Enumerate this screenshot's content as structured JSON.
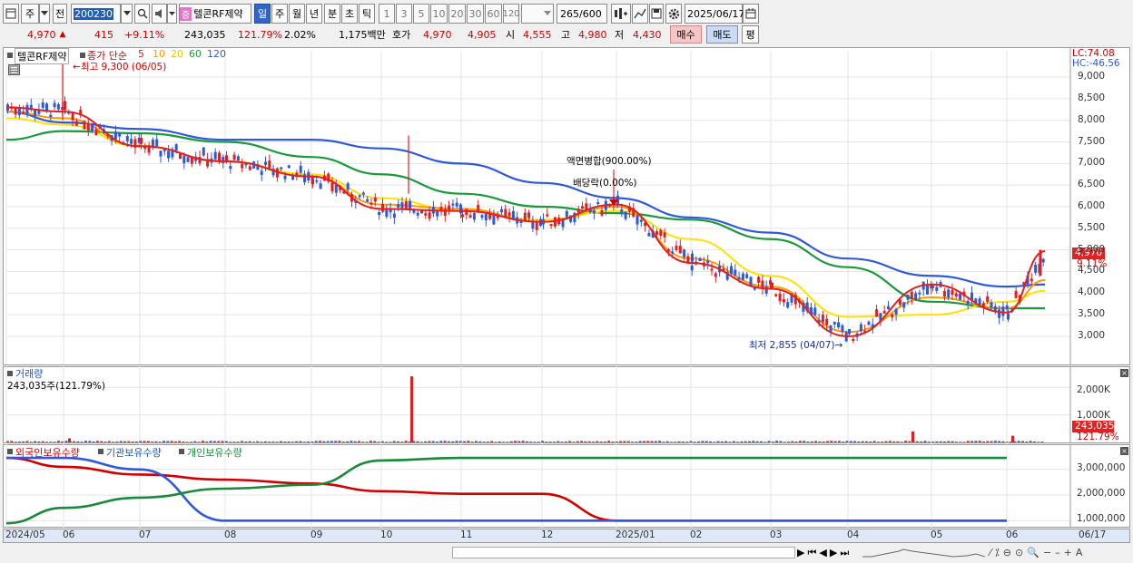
{
  "toolbar": {
    "market_label": "주",
    "prev_label": "전",
    "code": "200230",
    "stock_name": "텔콘RF제약",
    "stock_badge": "증",
    "periods": [
      "일",
      "주",
      "월",
      "년",
      "분",
      "초",
      "틱"
    ],
    "active_period": "일",
    "intervals": [
      "1",
      "3",
      "5",
      "10",
      "20",
      "30",
      "60",
      "120"
    ],
    "count": "265",
    "total": "/600",
    "date": "2025/06/17"
  },
  "quote": {
    "price": "4,970",
    "change": "415",
    "change_pct": "+9.11%",
    "volume": "243,035",
    "volume_ratio": "121.79%",
    "turnover_rate": "2.02%",
    "amount": "1,175백만",
    "ask_label": "호가",
    "ask1": "4,970",
    "ask2": "4,905",
    "open_label": "시",
    "open": "4,555",
    "high_label": "고",
    "high": "4,980",
    "low_label": "저",
    "low": "4,430",
    "buy_label": "매수",
    "sell_label": "매도",
    "eval_label": "평"
  },
  "price_chart": {
    "title": "텔콘RF제약",
    "ma_label": "종가 단순",
    "ma_periods": [
      "5",
      "10",
      "20",
      "60",
      "120"
    ],
    "ma_colors": [
      "#e02020",
      "#ff9a00",
      "#ffe000",
      "#1a9a3a",
      "#2f59d9"
    ],
    "lc": "LC:74.08",
    "hc": "HC:-46.56",
    "high_note": "최고 9,300 (06/05)",
    "low_note": "최저 2,855 (04/07)",
    "event1": "액면병합(900.00%)",
    "event2": "배당락(0.00%)",
    "y_ticks": [
      "9,000",
      "8,500",
      "8,000",
      "7,500",
      "7,000",
      "6,500",
      "6,000",
      "5,500",
      "5,000",
      "4,500",
      "4,000",
      "3,500",
      "3,000"
    ],
    "last_price": "4,970",
    "last_pct": "9.11%"
  },
  "volume_chart": {
    "title": "거래량",
    "value": "243,035주(121.79%)",
    "y_ticks": [
      "2,000K",
      "1,000K"
    ],
    "last": "243,035",
    "last_pct": "121.79%"
  },
  "holding_chart": {
    "legends": [
      "외국인보유수량",
      "기관보유수량",
      "개인보유수량"
    ],
    "y_ticks": [
      "3,000,000",
      "2,000,000",
      "1,000,000"
    ]
  },
  "x_axis": {
    "labels": [
      "2024/05",
      "06",
      "07",
      "08",
      "09",
      "10",
      "11",
      "12",
      "2025/01",
      "02",
      "03",
      "04",
      "05",
      "06"
    ],
    "end": "06/17"
  },
  "chart_data": [
    {
      "type": "line",
      "title": "텔콘RF제약",
      "x": [
        "2024/05",
        "06",
        "07",
        "08",
        "09",
        "10",
        "11",
        "12",
        "2025/01",
        "02",
        "03",
        "04",
        "05",
        "06",
        "06/17"
      ],
      "series": [
        {
          "name": "5",
          "values": [
            8300,
            8200,
            7400,
            7050,
            6700,
            5950,
            5900,
            5650,
            6050,
            4700,
            4100,
            3000,
            4200,
            3550,
            4970
          ]
        },
        {
          "name": "120",
          "values": [
            8200,
            7950,
            7800,
            7550,
            7550,
            7350,
            7000,
            6550,
            6200,
            5750,
            5400,
            4800,
            4400,
            4150,
            4200
          ]
        }
      ],
      "ylim": [
        2600,
        9400
      ]
    },
    {
      "type": "bar",
      "title": "거래량",
      "x": [
        "2024/05",
        "06",
        "07",
        "08",
        "09",
        "10",
        "11",
        "12",
        "2025/01",
        "02",
        "03",
        "04",
        "05",
        "06/17"
      ],
      "values": [
        40,
        150,
        30,
        20,
        20,
        2400,
        30,
        20,
        40,
        25,
        30,
        20,
        400,
        243
      ],
      "ylim": [
        0,
        2600
      ]
    },
    {
      "type": "line",
      "x": [
        "2024/05",
        "06",
        "07",
        "08",
        "09",
        "10",
        "11",
        "12",
        "2025/01",
        "02",
        "03",
        "04",
        "05",
        "06/17"
      ],
      "series": [
        {
          "name": "외국인보유수량",
          "values": [
            3450,
            3100,
            2800,
            2600,
            2450,
            2150,
            2050,
            2050,
            1000,
            1000,
            1000,
            1000,
            1000,
            1000
          ]
        },
        {
          "name": "기관보유수량",
          "values": [
            3450,
            3450,
            3000,
            1000,
            1000,
            1000,
            1000,
            1000,
            1000,
            1000,
            1000,
            1000,
            1000,
            1000
          ]
        },
        {
          "name": "개인보유수량",
          "values": [
            900,
            1500,
            1900,
            2250,
            2400,
            3350,
            3450,
            3450,
            3450,
            3450,
            3450,
            3450,
            3450,
            3450
          ]
        }
      ],
      "ylim": [
        800,
        3700
      ]
    }
  ]
}
